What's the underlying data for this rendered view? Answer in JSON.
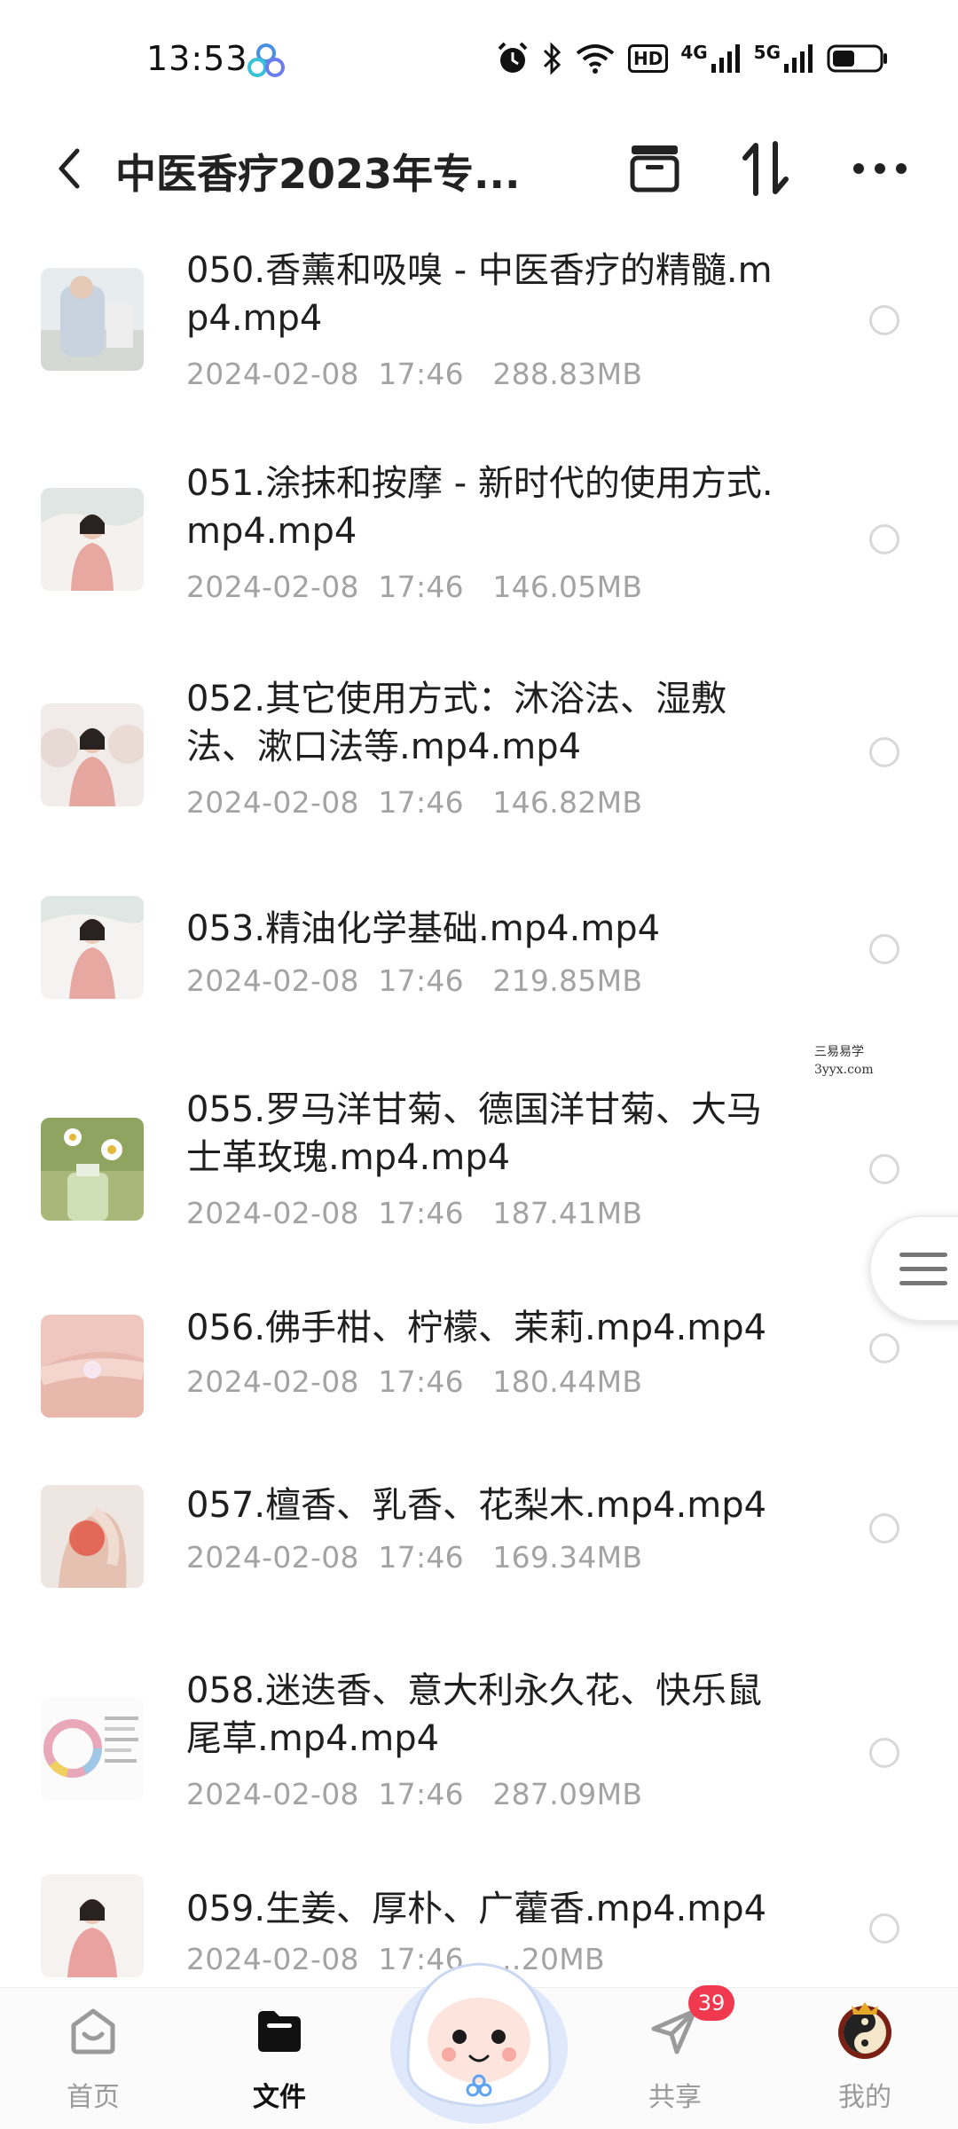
{
  "status_bar": {
    "time": "13:53",
    "hd_label": "HD",
    "net1_label": "4G",
    "net2_label": "5G",
    "icons": [
      "app-cloud-icon",
      "alarm-icon",
      "bluetooth-icon",
      "wifi-icon",
      "signal-icon",
      "battery-icon"
    ]
  },
  "header": {
    "title": "中医香疗2023年专...",
    "icons": [
      "back-icon",
      "archive-icon",
      "sort-icon",
      "more-icon"
    ]
  },
  "files": [
    {
      "name": "050.香薰和吸嗅 - 中医香疗的精髓.mp4.mp4",
      "meta": "2024-02-08  17:46   288.83MB"
    },
    {
      "name": "051.涂抹和按摩 - 新时代的使用方式.mp4.mp4",
      "meta": "2024-02-08  17:46   146.05MB"
    },
    {
      "name": "052.其它使用方式：沐浴法、湿敷法、漱口法等.mp4.mp4",
      "meta": "2024-02-08  17:46   146.82MB"
    },
    {
      "name": "053.精油化学基础.mp4.mp4",
      "meta": "2024-02-08  17:46   219.85MB"
    },
    {
      "name": "055.罗马洋甘菊、德国洋甘菊、大马士革玫瑰.mp4.mp4",
      "meta": "2024-02-08  17:46   187.41MB"
    },
    {
      "name": "056.佛手柑、柠檬、茉莉.mp4.mp4",
      "meta": "2024-02-08  17:46   180.44MB"
    },
    {
      "name": "057.檀香、乳香、花梨木.mp4.mp4",
      "meta": "2024-02-08  17:46   169.34MB"
    },
    {
      "name": "058.迷迭香、意大利永久花、快乐鼠尾草.mp4.mp4",
      "meta": "2024-02-08  17:46   287.09MB"
    },
    {
      "name": "059.生姜、厚朴、广藿香.mp4.mp4",
      "meta": "2024-02-08  17:46   ...20MB"
    }
  ],
  "watermark": {
    "line1": "三易易学",
    "line2": "3yyx.com"
  },
  "bottom_nav": {
    "items": [
      {
        "label": "首页",
        "icon": "home-icon",
        "active": false
      },
      {
        "label": "文件",
        "icon": "folder-icon",
        "active": true
      },
      {
        "label": "共享",
        "icon": "send-icon",
        "active": false
      },
      {
        "label": "我的",
        "icon": "avatar-icon",
        "active": false
      }
    ],
    "share_badge": "39"
  },
  "colors": {
    "accent_red": "#f0384e",
    "meta_gray": "#a3a3a3",
    "active_nav": "#111111"
  }
}
